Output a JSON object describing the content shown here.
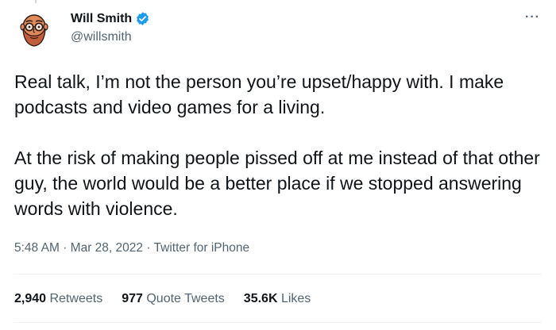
{
  "author": {
    "name": "Will Smith",
    "handle": "@willsmith",
    "verified": true,
    "avatar_icon": "bearded-man-with-glasses-cartoon"
  },
  "more_icon": "more-options-icon",
  "tweet": {
    "paragraphs": [
      "Real talk, I’m not the person you’re upset/happy with. I make podcasts and video games for a living.",
      "At the risk of making people pissed off at me instead of that other guy, the world would be a better place if we stopped answering words with violence."
    ]
  },
  "meta": {
    "time": "5:48 AM",
    "sep1": "·",
    "date": "Mar 28, 2022",
    "sep2": "·",
    "source": "Twitter for iPhone"
  },
  "stats": [
    {
      "count": "2,940",
      "label": "Retweets"
    },
    {
      "count": "977",
      "label": "Quote Tweets"
    },
    {
      "count": "35.6K",
      "label": "Likes"
    }
  ],
  "colors": {
    "verified_blue": "#1d9bf0",
    "text_primary": "#0f1419",
    "text_secondary": "#536471",
    "avatar_skin": "#e08a5b",
    "avatar_beard": "#c25e3a"
  }
}
